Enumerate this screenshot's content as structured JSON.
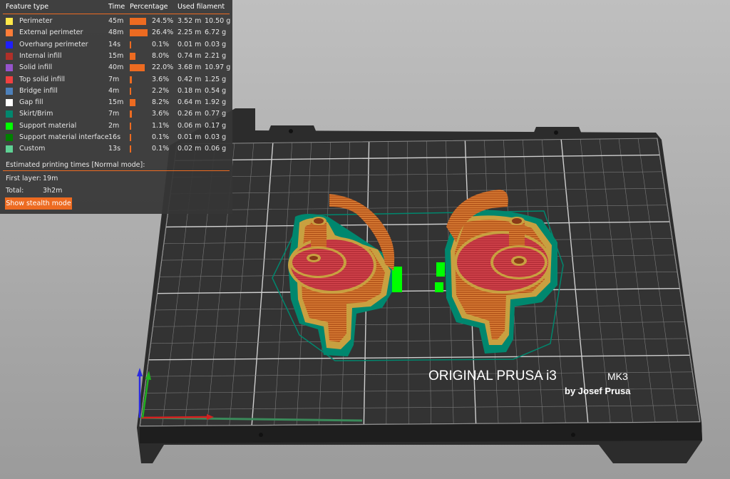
{
  "legend": {
    "headers": {
      "feature": "Feature type",
      "time": "Time",
      "percentage": "Percentage",
      "filament": "Used filament"
    },
    "rows": [
      {
        "name": "Perimeter",
        "time": "45m",
        "pct": "24.5%",
        "len": "3.52 m",
        "wt": "10.50 g",
        "color": "#ffe84a",
        "bar": 0.245
      },
      {
        "name": "External perimeter",
        "time": "48m",
        "pct": "26.4%",
        "len": "2.25 m",
        "wt": "6.72 g",
        "color": "#ff7d38",
        "bar": 0.264
      },
      {
        "name": "Overhang perimeter",
        "time": "14s",
        "pct": "0.1%",
        "len": "0.01 m",
        "wt": "0.03 g",
        "color": "#1f1fff",
        "bar": 0.001
      },
      {
        "name": "Internal infill",
        "time": "15m",
        "pct": "8.0%",
        "len": "0.74 m",
        "wt": "2.21 g",
        "color": "#b03029",
        "bar": 0.08
      },
      {
        "name": "Solid infill",
        "time": "40m",
        "pct": "22.0%",
        "len": "3.68 m",
        "wt": "10.97 g",
        "color": "#9654cc",
        "bar": 0.22
      },
      {
        "name": "Top solid infill",
        "time": "7m",
        "pct": "3.6%",
        "len": "0.42 m",
        "wt": "1.25 g",
        "color": "#f04040",
        "bar": 0.036
      },
      {
        "name": "Bridge infill",
        "time": "4m",
        "pct": "2.2%",
        "len": "0.18 m",
        "wt": "0.54 g",
        "color": "#4d80ba",
        "bar": 0.022
      },
      {
        "name": "Gap fill",
        "time": "15m",
        "pct": "8.2%",
        "len": "0.64 m",
        "wt": "1.92 g",
        "color": "#ffffff",
        "bar": 0.082
      },
      {
        "name": "Skirt/Brim",
        "time": "7m",
        "pct": "3.6%",
        "len": "0.26 m",
        "wt": "0.77 g",
        "color": "#00876e",
        "bar": 0.036
      },
      {
        "name": "Support material",
        "time": "2m",
        "pct": "1.1%",
        "len": "0.06 m",
        "wt": "0.17 g",
        "color": "#00ff00",
        "bar": 0.011
      },
      {
        "name": "Support material interface",
        "time": "16s",
        "pct": "0.1%",
        "len": "0.01 m",
        "wt": "0.03 g",
        "color": "#008000",
        "bar": 0.001
      },
      {
        "name": "Custom",
        "time": "13s",
        "pct": "0.1%",
        "len": "0.02 m",
        "wt": "0.06 g",
        "color": "#5ed194",
        "bar": 0.001
      }
    ],
    "estimated_title": "Estimated printing times [Normal mode]:",
    "first_layer_label": "First layer:",
    "first_layer_value": "19m",
    "total_label": "Total:",
    "total_value": "3h2m",
    "stealth_button": "Show stealth mode"
  },
  "bed": {
    "brand_line": "ORIGINAL PRUSA i3",
    "model": "MK3",
    "byline": "by Josef Prusa"
  },
  "colors": {
    "accent": "#ed6b21",
    "perimeter_orange": "#c2611f",
    "infill_red": "#c8313b",
    "skirt_green": "#00876e",
    "support_green": "#00ff00"
  },
  "icons": {
    "axis": "xyz-axis-icon"
  }
}
